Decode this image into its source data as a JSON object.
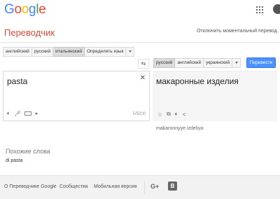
{
  "header": {
    "logo_letters": [
      {
        "ch": "G",
        "color": "#4285f4"
      },
      {
        "ch": "o",
        "color": "#ea4335"
      },
      {
        "ch": "o",
        "color": "#fbbc05"
      },
      {
        "ch": "g",
        "color": "#4285f4"
      },
      {
        "ch": "l",
        "color": "#34a853"
      },
      {
        "ch": "e",
        "color": "#ea4335"
      }
    ],
    "apps_icon": "apps-grid-icon",
    "notifications_icon": "bell-icon"
  },
  "title": {
    "text": "Переводчик",
    "color": "#dd4b39",
    "instant_link": "Отключить моментальный перевод"
  },
  "source_langs": {
    "items": [
      "английский",
      "русский",
      "итальянский",
      "Определить язык"
    ],
    "active_index": 2
  },
  "target_langs": {
    "items": [
      "русский",
      "английский",
      "украинский"
    ],
    "active_index": 0
  },
  "swap_icon": "swap-languages-icon",
  "translate_button": "Перевести",
  "source": {
    "text": "pasta",
    "char_count": "5/5000"
  },
  "result": {
    "text": "макаронные изделия",
    "transliteration": "makaronnyye izdeliya"
  },
  "similar": {
    "heading": "Похожие слова",
    "word": "di pasta"
  },
  "footer": {
    "about": "О Переводчике Google",
    "community": "Сообщества",
    "mobile": "Мобильная версия",
    "gplus_label": "G+",
    "blogger_label": "B"
  },
  "colors": {
    "accent_blue": "#4d90fe",
    "title_red": "#dd4b39"
  }
}
